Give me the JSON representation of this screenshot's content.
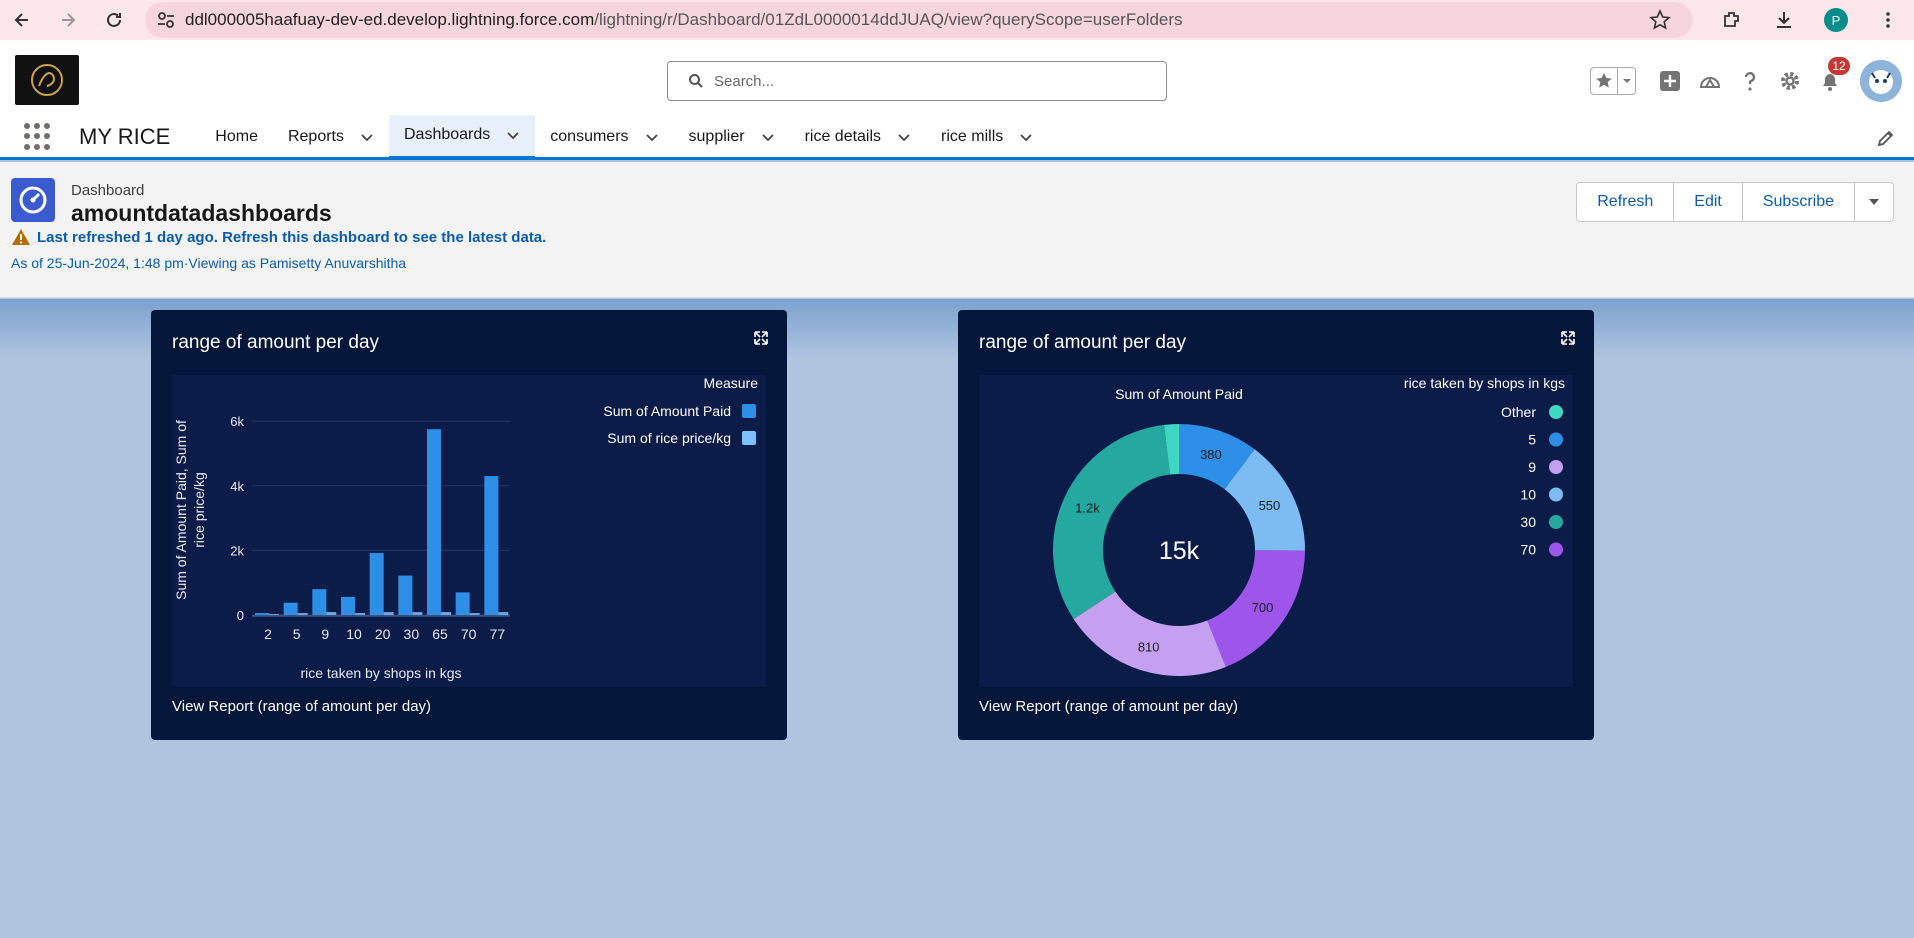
{
  "browser": {
    "url_domain": "ddl000005haafuay-dev-ed.develop.lightning.force.com",
    "url_path": "/lightning/r/Dashboard/01ZdL0000014ddJUAQ/view?queryScope=userFolders",
    "profile_initial": "P"
  },
  "header": {
    "search_placeholder": "Search...",
    "notification_count": "12"
  },
  "app_nav": {
    "app_name": "MY RICE",
    "items": [
      {
        "label": "Home",
        "has_menu": false,
        "active": false
      },
      {
        "label": "Reports",
        "has_menu": true,
        "active": false
      },
      {
        "label": "Dashboards",
        "has_menu": true,
        "active": true
      },
      {
        "label": "consumers",
        "has_menu": true,
        "active": false
      },
      {
        "label": "supplier",
        "has_menu": true,
        "active": false
      },
      {
        "label": "rice details",
        "has_menu": true,
        "active": false
      },
      {
        "label": "rice mills",
        "has_menu": true,
        "active": false
      }
    ]
  },
  "dashboard": {
    "kicker": "Dashboard",
    "title": "amountdatadashboards",
    "warning": "Last refreshed 1 day ago. Refresh this dashboard to see the latest data.",
    "as_of": "As of 25-Jun-2024, 1:48 pm·Viewing as Pamisetty Anuvarshitha",
    "buttons": {
      "refresh": "Refresh",
      "edit": "Edit",
      "subscribe": "Subscribe"
    }
  },
  "colors": {
    "accent": "#0176d3",
    "card_bg": "#05163b",
    "chart_bg": "#0c1c48"
  },
  "cards": [
    {
      "title": "range of amount per day",
      "footer": "View Report (range of amount per day)"
    },
    {
      "title": "range of amount per day",
      "footer": "View Report (range of amount per day)"
    }
  ],
  "chart_data": [
    {
      "type": "bar",
      "xlabel": "rice taken by shops in kgs",
      "ylabel": "Sum of Amount Paid, Sum of rice price/kg",
      "legend_title": "Measure",
      "legend_position": "top-right",
      "categories": [
        "2",
        "5",
        "9",
        "10",
        "20",
        "30",
        "65",
        "70",
        "77"
      ],
      "ylim": [
        0,
        6500
      ],
      "yticks": [
        "0",
        "2k",
        "4k",
        "6k"
      ],
      "series": [
        {
          "name": "Sum of Amount Paid",
          "color": "#2e8fe8",
          "values": [
            60,
            380,
            800,
            560,
            1920,
            1220,
            5750,
            700,
            4300
          ]
        },
        {
          "name": "Sum of rice price/kg",
          "color": "#7cc0ff",
          "values": [
            30,
            60,
            90,
            60,
            90,
            90,
            90,
            60,
            90
          ]
        }
      ]
    },
    {
      "type": "pie",
      "title": "Sum of Amount Paid",
      "center_label": "15k",
      "legend_title": "rice taken by shops in kgs",
      "legend_position": "top-right",
      "slices": [
        {
          "label": "5",
          "value": 380,
          "display": "380",
          "color": "#2e8fe8"
        },
        {
          "label": "10",
          "value": 550,
          "display": "550",
          "color": "#7cbcf2"
        },
        {
          "label": "70",
          "value": 700,
          "display": "700",
          "color": "#9e55ec"
        },
        {
          "label": "9",
          "value": 810,
          "display": "810",
          "color": "#c6a0f0"
        },
        {
          "label": "30",
          "value": 1200,
          "display": "1.2k",
          "color": "#25a89f"
        },
        {
          "label": "Other",
          "value": 70,
          "display": "",
          "color": "#40d6c4"
        }
      ],
      "legend": [
        {
          "label": "Other",
          "color": "#40d6c4"
        },
        {
          "label": "5",
          "color": "#2e8fe8"
        },
        {
          "label": "9",
          "color": "#c6a0f0"
        },
        {
          "label": "10",
          "color": "#7cbcf2"
        },
        {
          "label": "30",
          "color": "#25a89f"
        },
        {
          "label": "70",
          "color": "#9e55ec"
        }
      ]
    }
  ]
}
